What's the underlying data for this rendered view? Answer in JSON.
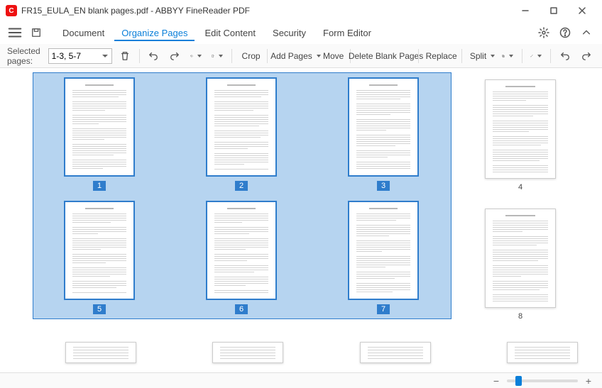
{
  "window": {
    "title": "FR15_EULA_EN blank pages.pdf - ABBYY FineReader PDF",
    "app_badge": "C"
  },
  "menu": {
    "document": "Document",
    "organize": "Organize Pages",
    "edit": "Edit Content",
    "security": "Security",
    "form": "Form Editor"
  },
  "toolbar": {
    "selected_label": "Selected pages:",
    "selected_value": "1-3, 5-7",
    "crop": "Crop",
    "add_pages": "Add Pages",
    "move": "Move",
    "delete_blank": "Delete Blank Pages",
    "replace": "Replace",
    "split": "Split"
  },
  "pages": {
    "selected": [
      "1",
      "2",
      "3",
      "5",
      "6",
      "7"
    ],
    "unselected": [
      "4",
      "8"
    ]
  },
  "zoom": {
    "minus": "−",
    "plus": "+"
  }
}
